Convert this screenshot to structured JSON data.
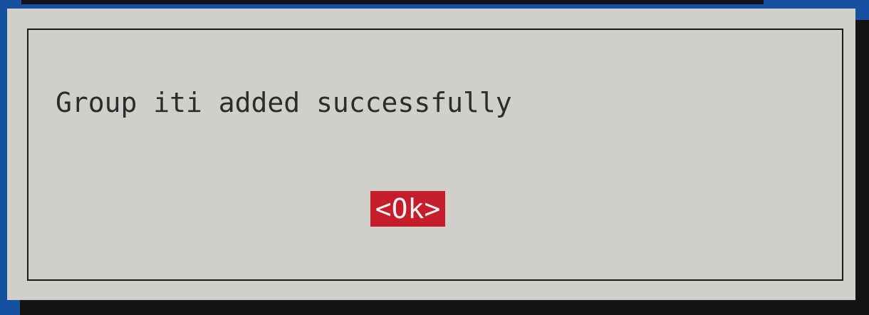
{
  "dialog": {
    "message": "Group iti added successfully",
    "ok_label": "<Ok>"
  },
  "colors": {
    "background": "#1650a0",
    "dialog": "#d1cfca",
    "shadow": "#131313",
    "button": "#c51d2c",
    "text": "#2c2c2c"
  }
}
